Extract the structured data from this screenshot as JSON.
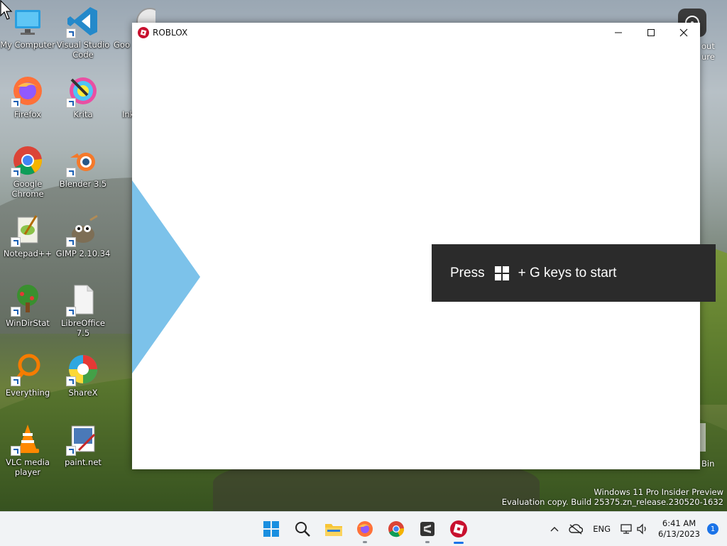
{
  "desktop": {
    "icons": [
      {
        "name": "my-computer",
        "label": "My Computer"
      },
      {
        "name": "visual-studio-code",
        "label": "Visual Studio Code"
      },
      {
        "name": "google-partial",
        "label": "Goo"
      },
      {
        "name": "firefox",
        "label": "Firefox"
      },
      {
        "name": "krita",
        "label": "Krita"
      },
      {
        "name": "inkscape-partial",
        "label": "Ink"
      },
      {
        "name": "google-chrome",
        "label": "Google Chrome"
      },
      {
        "name": "blender",
        "label": "Blender 3.5"
      },
      {
        "name": "notepadpp",
        "label": "Notepad++"
      },
      {
        "name": "gimp",
        "label": "GIMP 2.10.34"
      },
      {
        "name": "windirstat",
        "label": "WinDirStat"
      },
      {
        "name": "libreoffice",
        "label": "LibreOffice 7.5"
      },
      {
        "name": "everything",
        "label": "Everything"
      },
      {
        "name": "sharex",
        "label": "ShareX"
      },
      {
        "name": "vlc",
        "label": "VLC media player"
      },
      {
        "name": "paintnet",
        "label": "paint.net"
      }
    ],
    "right_fragments": {
      "about_1": "out",
      "about_2": "ure",
      "recycle": "Bin"
    },
    "watermark": {
      "line1": "Windows 11 Pro Insider Preview",
      "line2": "Evaluation copy. Build 25375.zn_release.230520-1632"
    }
  },
  "window": {
    "title": "ROBLOX",
    "minimize": "—",
    "maximize": "☐",
    "close": "✕"
  },
  "gamebar_prompt": {
    "press": "Press",
    "rest": "+ G keys to start"
  },
  "taskbar": {
    "apps": [
      {
        "name": "start",
        "icon": "windows-logo-icon"
      },
      {
        "name": "search",
        "icon": "search-icon"
      },
      {
        "name": "file-explorer",
        "icon": "folder-icon"
      },
      {
        "name": "firefox",
        "icon": "firefox-icon"
      },
      {
        "name": "chrome",
        "icon": "chrome-icon"
      },
      {
        "name": "sublime",
        "icon": "sublime-icon"
      },
      {
        "name": "roblox",
        "icon": "roblox-icon"
      }
    ],
    "tray": {
      "language": "ENG",
      "time": "6:41 AM",
      "date": "6/13/2023",
      "notifications": "1"
    }
  },
  "colors": {
    "accent": "#1a73e8",
    "roblox_red": "#c8102e",
    "gamebar_bg": "#2b2b2b",
    "triangle": "#7cc2ea"
  }
}
